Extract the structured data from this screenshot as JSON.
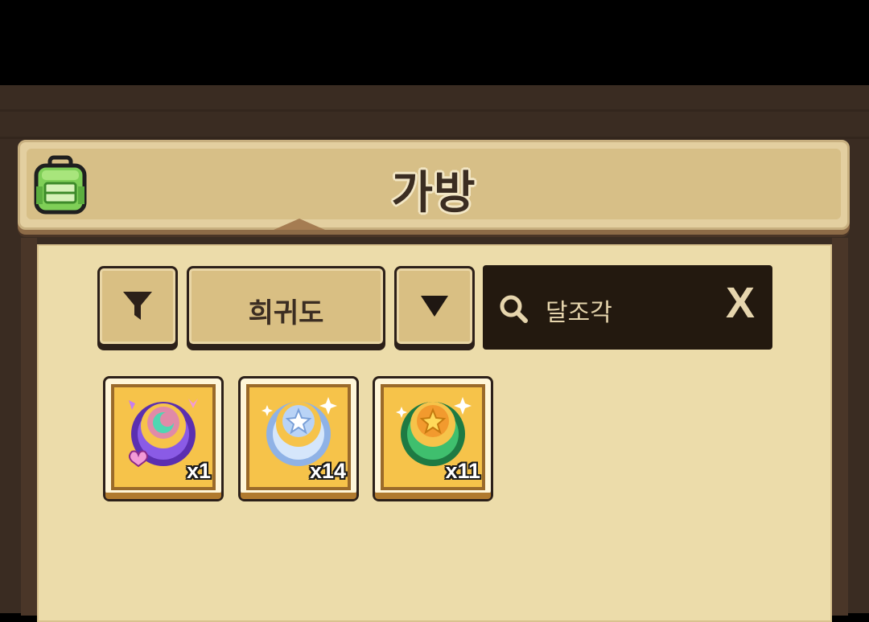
{
  "header": {
    "title": "가방",
    "icon": "backpack-icon"
  },
  "filters": {
    "filter_icon": "funnel-icon",
    "rarity_label": "희귀도",
    "sort_icon": "triangle-down-icon"
  },
  "search": {
    "icon": "search-icon",
    "value": "달조각",
    "clear_label": "X"
  },
  "items": [
    {
      "name": "purple-moon-fragment",
      "quantity": "x1",
      "color": "#7b4dd6"
    },
    {
      "name": "blue-moon-fragment",
      "quantity": "x14",
      "color": "#9fc3f0"
    },
    {
      "name": "green-moon-fragment",
      "quantity": "x11",
      "color": "#2fa35a"
    }
  ],
  "colors": {
    "panel_bg": "#ecdcaa",
    "header_bg": "#d7bf87",
    "button_bg": "#d9bf83",
    "search_bg": "#23190f",
    "text_dark": "#3b2d22",
    "slot_gold": "#f6c34a"
  }
}
